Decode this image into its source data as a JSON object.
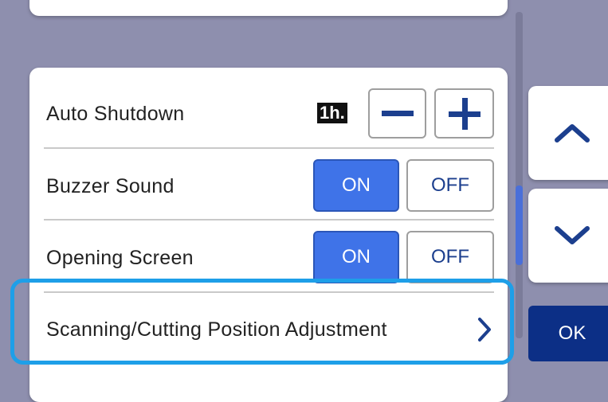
{
  "settings": {
    "auto_shutdown": {
      "label": "Auto Shutdown",
      "value": "1h.",
      "minus": "−",
      "plus": "+"
    },
    "buzzer_sound": {
      "label": "Buzzer Sound",
      "on_label": "ON",
      "off_label": "OFF",
      "selected": "ON"
    },
    "opening_screen": {
      "label": "Opening Screen",
      "on_label": "ON",
      "off_label": "OFF",
      "selected": "ON"
    },
    "position_adjustment": {
      "label": "Scanning/Cutting Position Adjustment",
      "arrow": "›"
    }
  },
  "side_controls": {
    "up_icon": "chevron-up-icon",
    "down_icon": "chevron-down-icon",
    "ok_label": "OK"
  },
  "colors": {
    "active": "#3f73e8",
    "ok": "#0c2f86",
    "highlight": "#1e9fe8",
    "background": "#8e8fae"
  }
}
